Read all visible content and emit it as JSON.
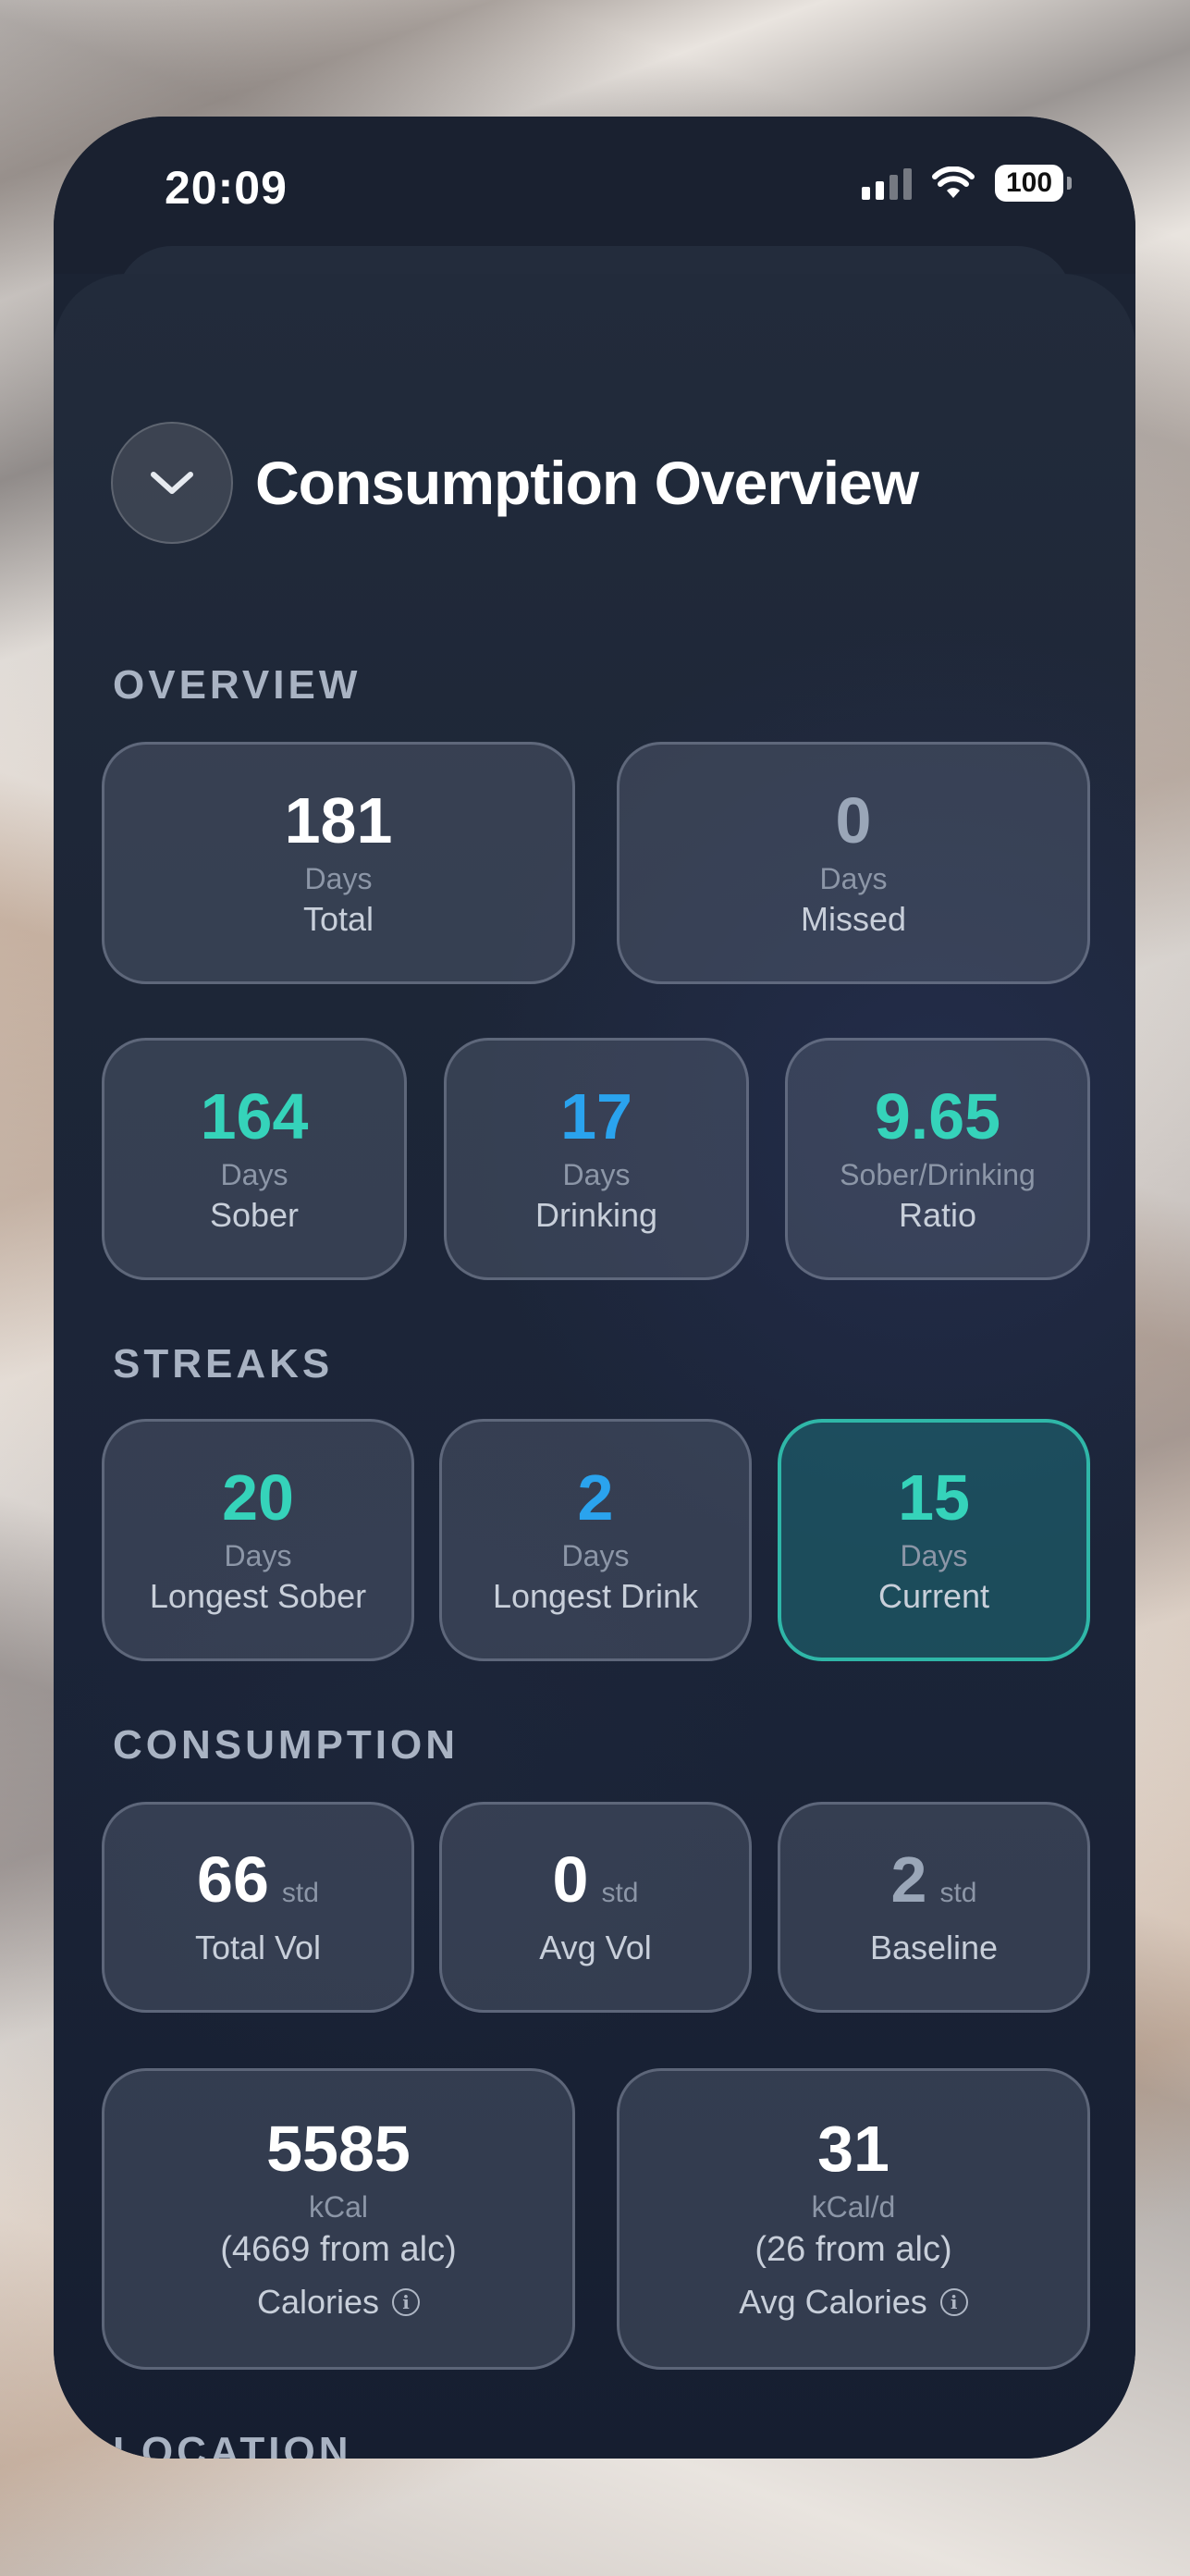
{
  "status_bar": {
    "time": "20:09",
    "battery": "100"
  },
  "header": {
    "title": "Consumption Overview"
  },
  "sections": {
    "overview": "OVERVIEW",
    "streaks": "STREAKS",
    "consumption": "CONSUMPTION",
    "location": "LOCATION"
  },
  "overview": {
    "total": {
      "value": "181",
      "unit": "Days",
      "label": "Total"
    },
    "missed": {
      "value": "0",
      "unit": "Days",
      "label": "Missed"
    },
    "sober": {
      "value": "164",
      "unit": "Days",
      "label": "Sober"
    },
    "drinking": {
      "value": "17",
      "unit": "Days",
      "label": "Drinking"
    },
    "ratio": {
      "value": "9.65",
      "unit": "Sober/Drinking",
      "label": "Ratio"
    }
  },
  "streaks": {
    "longest_sober": {
      "value": "20",
      "unit": "Days",
      "label": "Longest Sober"
    },
    "longest_drink": {
      "value": "2",
      "unit": "Days",
      "label": "Longest Drink"
    },
    "current": {
      "value": "15",
      "unit": "Days",
      "label": "Current"
    }
  },
  "consumption": {
    "total_vol": {
      "value": "66",
      "unit": "std",
      "label": "Total Vol"
    },
    "avg_vol": {
      "value": "0",
      "unit": "std",
      "label": "Avg Vol"
    },
    "baseline": {
      "value": "2",
      "unit": "std",
      "label": "Baseline"
    },
    "calories": {
      "value": "5585",
      "unit": "kCal",
      "detail": "(4669 from alc)",
      "label": "Calories"
    },
    "avg_calories": {
      "value": "31",
      "unit": "kCal/d",
      "detail": "(26 from alc)",
      "label": "Avg Calories"
    }
  },
  "colors": {
    "sober": "#35d3ba",
    "drinking": "#2aa3ee",
    "current_border": "#2fb7a8"
  },
  "icons": {
    "back": "chevron-down-icon",
    "info": "info-icon"
  }
}
